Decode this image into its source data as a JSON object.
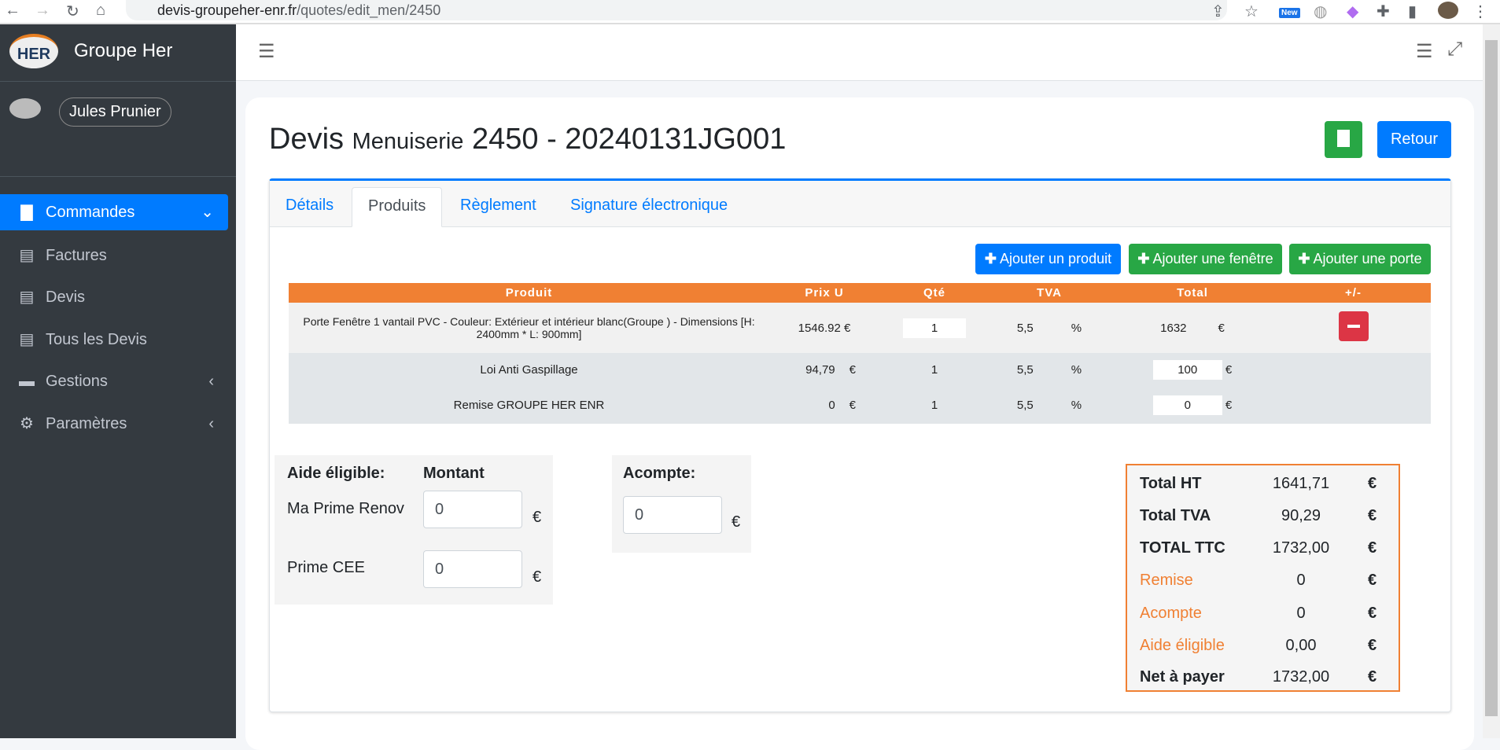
{
  "browser": {
    "url_host": "devis-groupeher-enr.fr",
    "url_path": "/quotes/edit_men/2450",
    "ext_badge": "New"
  },
  "sidebar": {
    "logo_text": "HER",
    "brand": "Groupe Her",
    "user": "Jules Prunier",
    "items": [
      {
        "label": "Commandes",
        "icon": "file-icon",
        "active": true
      },
      {
        "label": "Factures",
        "icon": "invoice-icon"
      },
      {
        "label": "Devis",
        "icon": "file-text-icon"
      },
      {
        "label": "Tous les Devis",
        "icon": "file-text-icon"
      },
      {
        "label": "Gestions",
        "icon": "store-icon"
      },
      {
        "label": "Paramètres",
        "icon": "gear-icon"
      }
    ]
  },
  "page": {
    "title_main": "Devis",
    "title_sub": "Menuiserie",
    "title_ref": "2450 - 20240131JG001",
    "retour": "Retour"
  },
  "tabs": [
    "Détails",
    "Produits",
    "Règlement",
    "Signature électronique"
  ],
  "actions": {
    "add_product": "Ajouter un produit",
    "add_window": "Ajouter une fenêtre",
    "add_door": "Ajouter une porte"
  },
  "table": {
    "headers": [
      "Produit",
      "Prix U",
      "Qté",
      "TVA",
      "Total",
      "+/-"
    ],
    "rows": [
      {
        "product": "Porte Fenêtre 1 vantail PVC - Couleur: Extérieur et intérieur blanc(Groupe ) - Dimensions [H: 2400mm * L: 900mm]",
        "price": "1546.92 €",
        "qty": "1",
        "tva": "5,5",
        "pct": "%",
        "total": "1632",
        "cur": "€"
      },
      {
        "product": "Loi Anti Gaspillage",
        "price": "94,79",
        "price_cur": "€",
        "qty": "1",
        "tva": "5,5",
        "pct": "%",
        "total": "100",
        "cur": "€"
      },
      {
        "product": "Remise GROUPE HER ENR",
        "price": "0",
        "price_cur": "€",
        "qty": "1",
        "tva": "5,5",
        "pct": "%",
        "total": "0",
        "cur": "€"
      }
    ]
  },
  "aide": {
    "title": "Aide éligible:",
    "montant": "Montant",
    "mpr_label": "Ma Prime Renov",
    "mpr_value": "0",
    "cee_label": "Prime CEE",
    "cee_value": "0",
    "cur": "€"
  },
  "acompte": {
    "title": "Acompte:",
    "value": "0",
    "cur": "€"
  },
  "totals": [
    {
      "k": "Total HT",
      "v": "1641,71",
      "e": "€"
    },
    {
      "k": "Total TVA",
      "v": "90,29",
      "e": "€"
    },
    {
      "k": "TOTAL TTC",
      "v": "1732,00",
      "e": "€"
    },
    {
      "k": "Remise",
      "v": "0",
      "e": "€"
    },
    {
      "k": "Acompte",
      "v": "0",
      "e": "€"
    },
    {
      "k": "Aide éligible",
      "v": "0,00",
      "e": "€"
    },
    {
      "k": "Net à payer",
      "v": "1732,00",
      "e": "€"
    }
  ],
  "colors": {
    "primary": "#007bff",
    "success": "#28a745",
    "danger": "#dc3545",
    "orange": "#f08033",
    "sidebar": "#343a40"
  }
}
